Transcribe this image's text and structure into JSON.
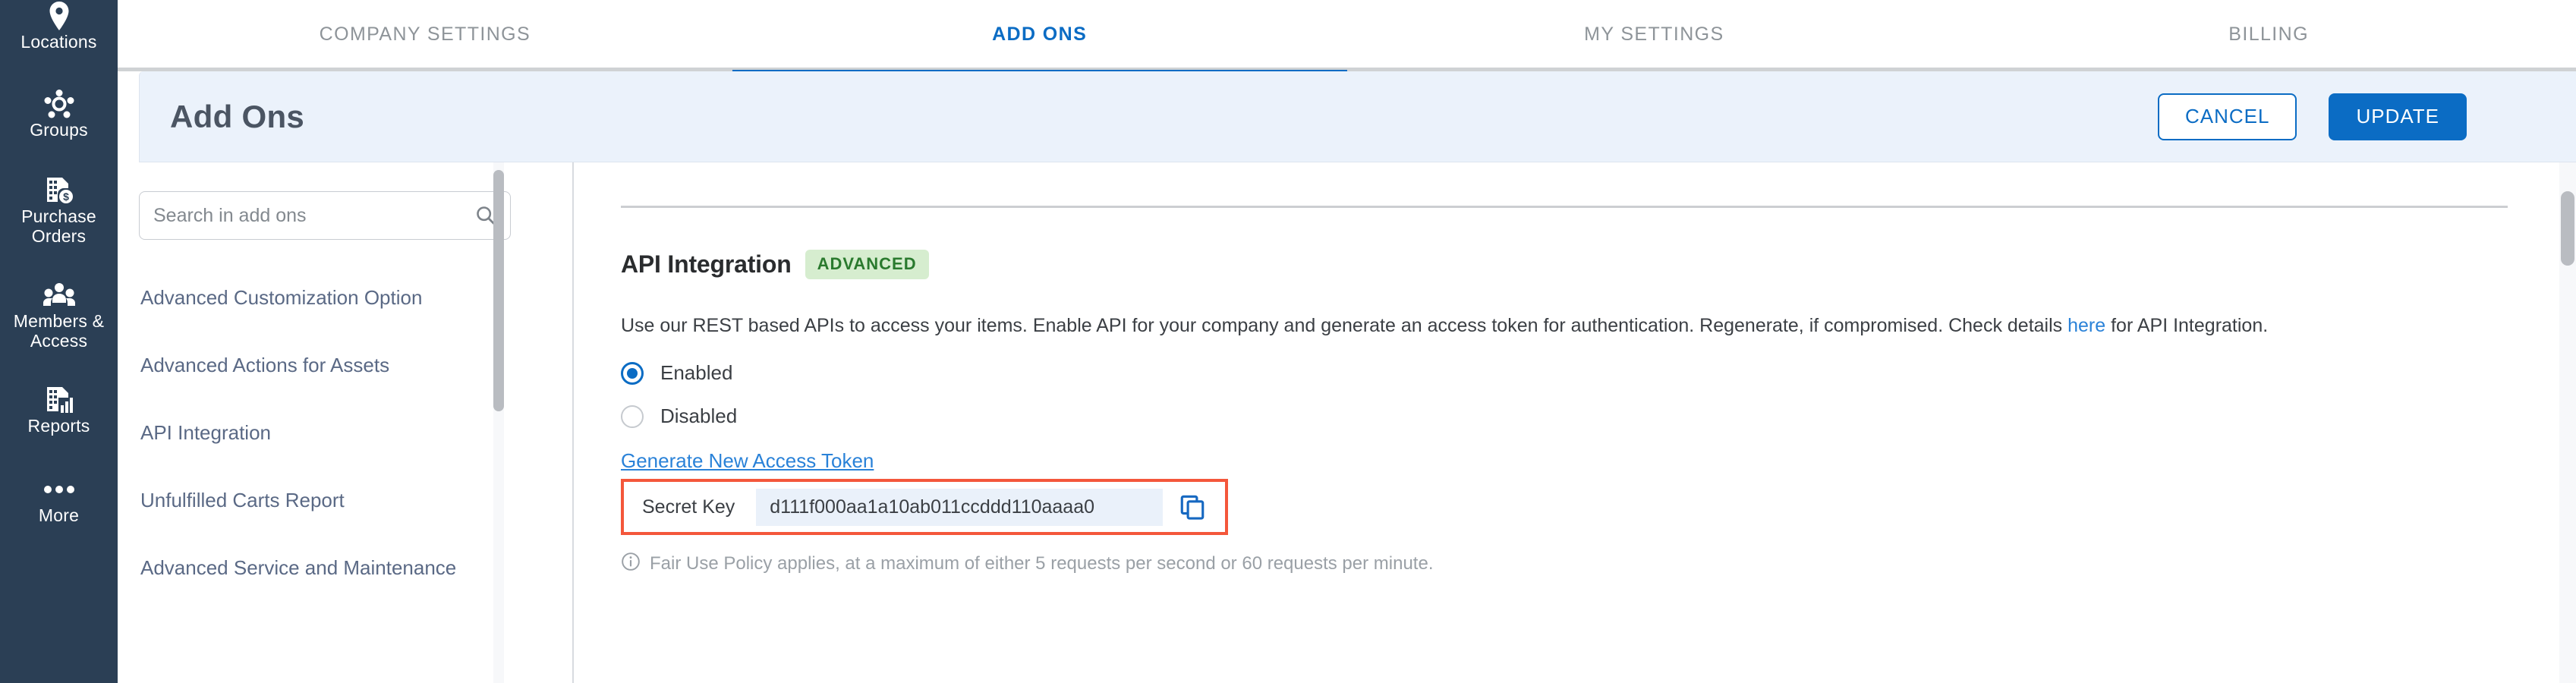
{
  "colors": {
    "nav_bg": "#2b3f55",
    "accent_blue": "#0b6cc4",
    "link_blue": "#2a82d8",
    "header_bg": "#ebf2fb",
    "badge_bg": "#d6edcf",
    "badge_text": "#2a7a2e",
    "highlight_red": "#f4573b",
    "list_text": "#5a6985"
  },
  "sidebar": {
    "items": [
      {
        "label": "Locations",
        "icon": "map-pin-icon"
      },
      {
        "label": "Groups",
        "icon": "groups-icon"
      },
      {
        "label": "Purchase Orders",
        "icon": "purchase-order-icon"
      },
      {
        "label": "Members & Access",
        "icon": "members-icon"
      },
      {
        "label": "Reports",
        "icon": "reports-icon"
      },
      {
        "label": "More",
        "icon": "ellipsis-icon"
      }
    ]
  },
  "tabs": [
    {
      "label": "COMPANY SETTINGS",
      "active": false
    },
    {
      "label": "ADD ONS",
      "active": true
    },
    {
      "label": "MY SETTINGS",
      "active": false
    },
    {
      "label": "BILLING",
      "active": false
    }
  ],
  "header": {
    "title": "Add Ons",
    "cancel_label": "CANCEL",
    "update_label": "UPDATE"
  },
  "search": {
    "placeholder": "Search in add ons",
    "value": "",
    "icon": "search-icon"
  },
  "addons": [
    {
      "label": "Advanced Customization Option"
    },
    {
      "label": "Advanced Actions for Assets"
    },
    {
      "label": "API Integration"
    },
    {
      "label": "Unfulfilled Carts Report"
    },
    {
      "label": "Advanced Service and Maintenance"
    }
  ],
  "detail": {
    "heading": "API Integration",
    "badge": "ADVANCED",
    "description_part1": "Use our REST based APIs to access your items. Enable API for your company and generate an access token for authentication. Regenerate, if compromised. Check details ",
    "description_link": "here",
    "description_part2": " for API Integration.",
    "radio_options": [
      {
        "label": "Enabled",
        "checked": true
      },
      {
        "label": "Disabled",
        "checked": false
      }
    ],
    "generate_link": "Generate New Access Token",
    "secret_key_label": "Secret Key",
    "secret_key_value": "d111f000aa1a10ab011ccddd110aaaa0",
    "copy_icon": "copy-icon",
    "fair_use_icon": "info-icon",
    "fair_use_text": "Fair Use Policy applies, at a maximum of either 5 requests per second or 60 requests per minute."
  }
}
